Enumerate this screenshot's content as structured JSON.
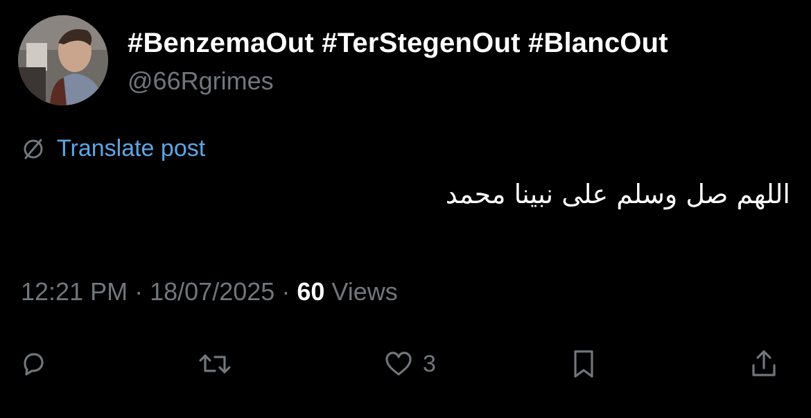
{
  "post": {
    "display_name": "#BenzemaOut #TerStegenOut #BlancOut",
    "handle": "@66Rgrimes",
    "translate_label": "Translate post",
    "text": "اللهم صل وسلم على نبينا محمد",
    "time": "12:21 PM",
    "date": "18/07/2025",
    "views_count": "60",
    "views_label": "Views",
    "separator": "·"
  },
  "actions": {
    "reply_icon": "reply-icon",
    "repost_icon": "repost-icon",
    "like_icon": "heart-icon",
    "like_count": "3",
    "bookmark_icon": "bookmark-icon",
    "share_icon": "share-icon"
  },
  "colors": {
    "background": "#000000",
    "primary_text": "#ffffff",
    "secondary_text": "#71767b",
    "link": "#5ea6e6"
  }
}
